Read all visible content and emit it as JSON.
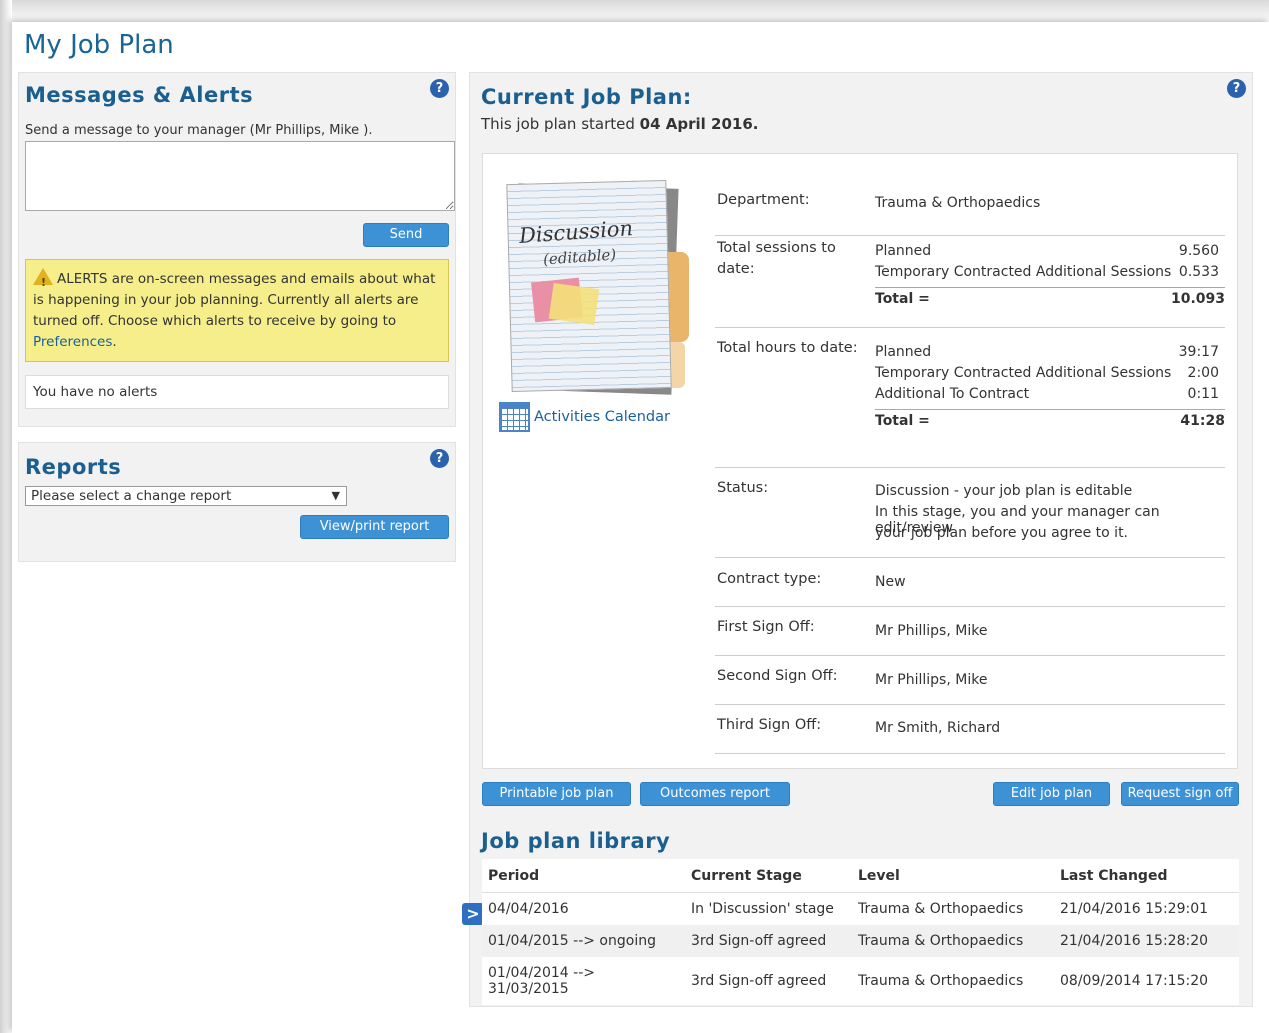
{
  "page_title": "My Job Plan",
  "messages": {
    "title": "Messages & Alerts",
    "help": "?",
    "send_label": "Send a message to your manager (Mr Phillips, Mike ).",
    "textarea_value": "",
    "send_button": "Send",
    "alert_prefix": "ALERTS are on-screen messages and emails about what is happening in your job planning. Currently all alerts are turned off. Choose which alerts to receive by going to ",
    "alert_link": "Preferences",
    "alert_suffix": ".",
    "no_alerts": "You have no alerts"
  },
  "reports": {
    "title": "Reports",
    "help": "?",
    "select_value": "Please select a change report",
    "view_button": "View/print report"
  },
  "current_plan": {
    "title": "Current Job Plan:",
    "help": "?",
    "started_prefix": "This job plan started ",
    "started_date": "04 April 2016.",
    "notebook_title": "Discussion",
    "notebook_sub": "(editable)",
    "calendar_link": "Activities Calendar",
    "department_label": "Department:",
    "department_value": "Trauma & Orthopaedics",
    "sessions_label_1": "Total sessions to",
    "sessions_label_2": "date:",
    "sessions": [
      {
        "label": "Planned",
        "value": "9.560"
      },
      {
        "label": "Temporary Contracted Additional Sessions",
        "value": "0.533"
      }
    ],
    "sessions_total_label": "Total =",
    "sessions_total": "10.093",
    "hours_label": "Total hours to date:",
    "hours": [
      {
        "label": "Planned",
        "value": "39:17"
      },
      {
        "label": "Temporary Contracted Additional Sessions",
        "value": "2:00"
      },
      {
        "label": "Additional To Contract",
        "value": "0:11"
      }
    ],
    "hours_total_label": "Total =",
    "hours_total": "41:28",
    "status_label": "Status:",
    "status_value": "Discussion - your job plan is editable",
    "status_note_1": "In this stage, you and your manager can edit/review",
    "status_note_2": "your job plan before you agree to it.",
    "contract_label": "Contract type:",
    "contract_value": "New",
    "first_signoff_label": "First Sign Off:",
    "first_signoff_value": "Mr Phillips, Mike",
    "second_signoff_label": "Second Sign Off:",
    "second_signoff_value": "Mr Phillips, Mike",
    "third_signoff_label": "Third Sign Off:",
    "third_signoff_value": "Mr Smith, Richard",
    "buttons": {
      "printable": "Printable job plan",
      "outcomes": "Outcomes report",
      "edit": "Edit job plan",
      "request": "Request sign off"
    }
  },
  "library": {
    "title": "Job plan library",
    "columns": [
      "Period",
      "Current Stage",
      "Level",
      "Last Changed"
    ],
    "rows": [
      [
        "04/04/2016",
        "In 'Discussion' stage",
        "Trauma & Orthopaedics",
        "21/04/2016 15:29:01"
      ],
      [
        "01/04/2015 --> ongoing",
        "3rd Sign-off agreed",
        "Trauma & Orthopaedics",
        "21/04/2016 15:28:20"
      ],
      [
        "01/04/2014 --> 31/03/2015",
        "3rd Sign-off agreed",
        "Trauma & Orthopaedics",
        "08/09/2014 17:15:20"
      ]
    ],
    "selected_marker": ">"
  }
}
